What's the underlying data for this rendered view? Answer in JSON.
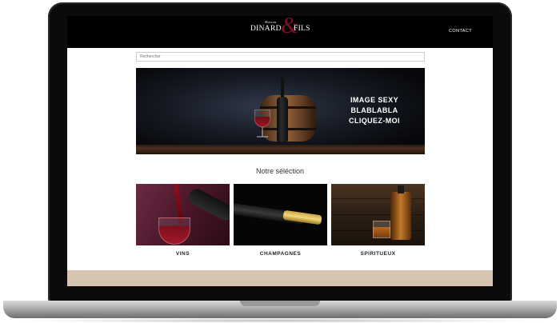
{
  "header": {
    "logo": {
      "maison": "Maison",
      "dinard": "DINARD",
      "ampersand": "&",
      "fils": "FILS"
    },
    "contact_label": "CONTACT"
  },
  "search": {
    "placeholder": "Rechercher"
  },
  "hero": {
    "lines": [
      "IMAGE SEXY",
      "BLABLABLA",
      "CLIQUEZ-MOI"
    ],
    "slides": 3,
    "active_slide": 1
  },
  "selection": {
    "title": "Notre séléction",
    "cards": [
      {
        "label": "VINS"
      },
      {
        "label": "CHAMPAGNES"
      },
      {
        "label": "SPIRITUEUX"
      }
    ]
  },
  "colors": {
    "header_bg": "#000000",
    "accent": "#7a1326",
    "footer_band": "#d6c6b1"
  }
}
